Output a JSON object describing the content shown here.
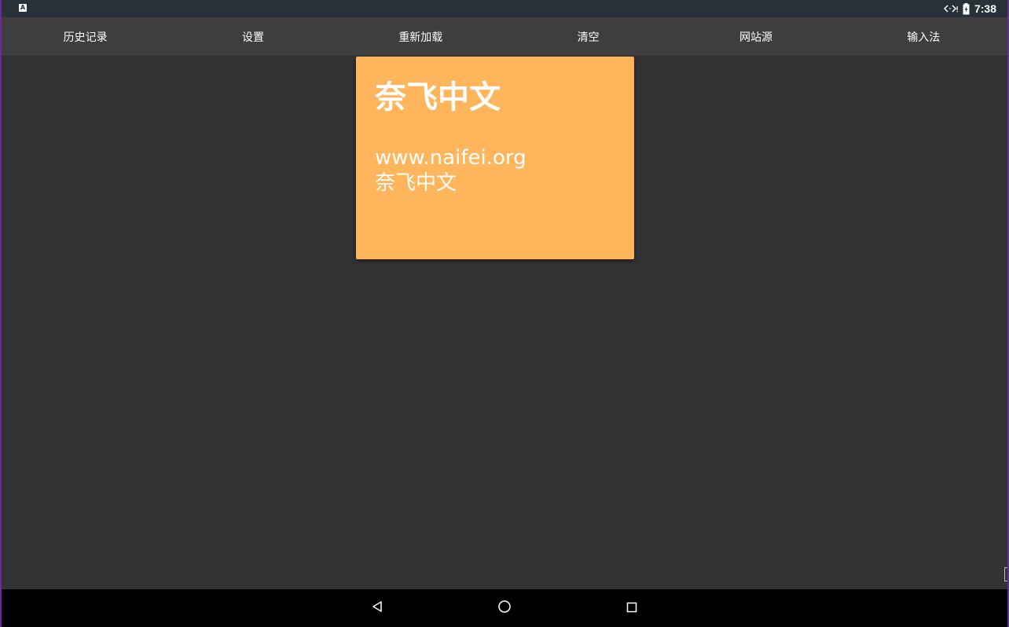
{
  "status_bar": {
    "app_icon": "A",
    "signal_icon": "network-arrows-icon",
    "battery_icon": "battery-charging-icon",
    "time": "7:38"
  },
  "toolbar": {
    "items": [
      {
        "label": "历史记录"
      },
      {
        "label": "设置"
      },
      {
        "label": "重新加载"
      },
      {
        "label": "清空"
      },
      {
        "label": "网站源"
      },
      {
        "label": "输入法"
      }
    ]
  },
  "source_card": {
    "title": "奈飞中文",
    "url": "www.naifei.org",
    "description": "奈飞中文",
    "color": "#ffb55b"
  },
  "nav_bar": {
    "back_icon": "back-triangle-icon",
    "home_icon": "home-circle-icon",
    "recents_icon": "recents-square-icon"
  },
  "colors": {
    "background": "#323232",
    "toolbar": "#3e3e3e",
    "status_bar": "#263238",
    "nav_bar": "#000000"
  }
}
